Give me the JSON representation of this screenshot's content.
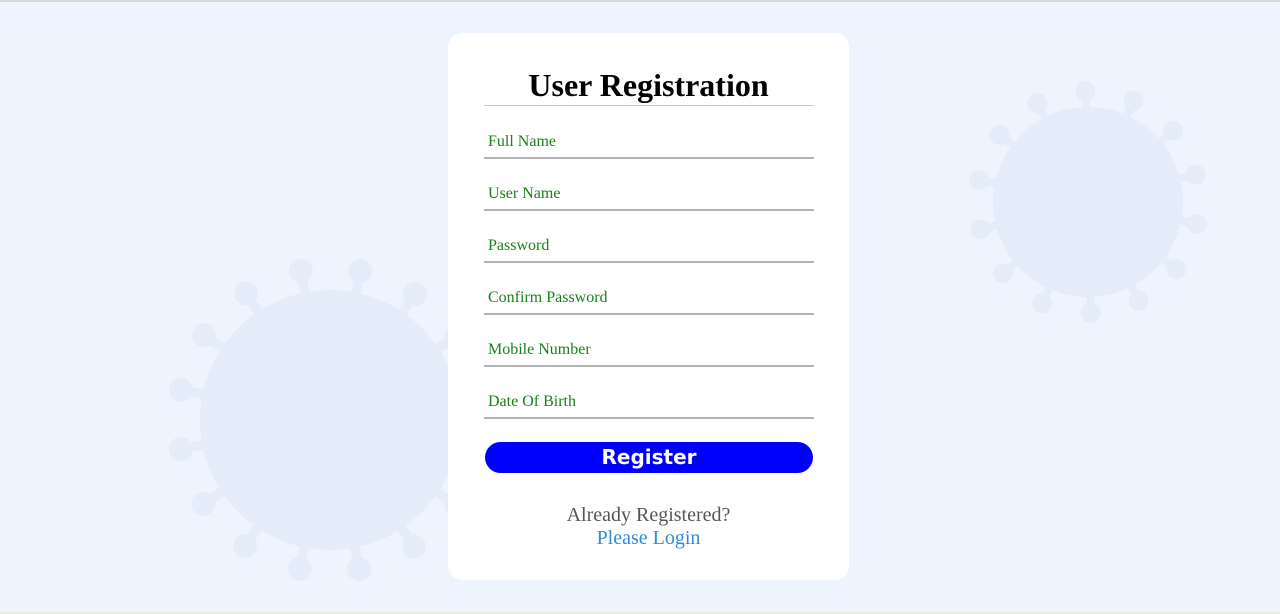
{
  "colors": {
    "background": "#eef4fd",
    "virus_decoration": "#e3ecf8",
    "placeholder_text": "#1a7f1a",
    "register_button": "#0000ff",
    "login_link": "#2f8bd6"
  },
  "form": {
    "title": "User Registration",
    "fields": {
      "full_name": {
        "placeholder": "Full Name",
        "value": ""
      },
      "user_name": {
        "placeholder": "User Name",
        "value": ""
      },
      "password": {
        "placeholder": "Password",
        "value": ""
      },
      "confirm_password": {
        "placeholder": "Confirm Password",
        "value": ""
      },
      "mobile_number": {
        "placeholder": "Mobile Number",
        "value": ""
      },
      "date_of_birth": {
        "placeholder": "Date Of Birth",
        "value": ""
      }
    },
    "register_label": "Register",
    "already_text": "Already Registered?",
    "login_link_text": "Please Login"
  },
  "decorations": {
    "icons": [
      "virus-icon",
      "virus-icon"
    ]
  }
}
